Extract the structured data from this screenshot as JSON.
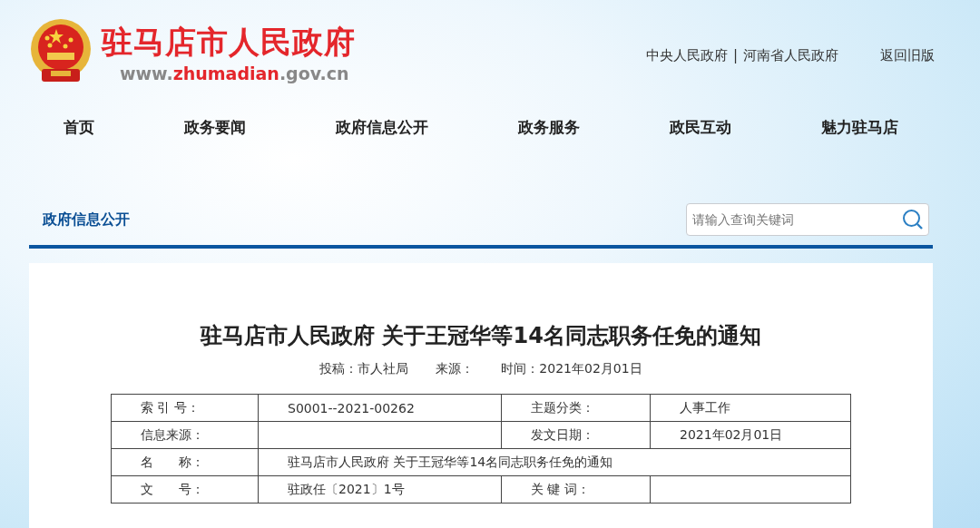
{
  "site": {
    "name": "驻马店市人民政府",
    "url": {
      "prefix": "www.",
      "name": "zhumadian",
      "suffix": ".gov.cn"
    }
  },
  "top_links": [
    "中央人民政府",
    "河南省人民政府"
  ],
  "top_links_separator": "|",
  "old_version_link": "返回旧版",
  "nav": [
    "首页",
    "政务要闻",
    "政府信息公开",
    "政务服务",
    "政民互动",
    "魅力驻马店"
  ],
  "section": {
    "title": "政府信息公开"
  },
  "search": {
    "placeholder": "请输入查询关键词"
  },
  "article": {
    "title": "驻马店市人民政府 关于王冠华等14名同志职务任免的通知",
    "meta": [
      {
        "label": "投稿：",
        "value": "市人社局"
      },
      {
        "label": "来源："
      },
      {
        "label": "时间：",
        "value": "2021年02月01日"
      }
    ],
    "info_table": [
      {
        "label_1": "索 引 号：",
        "value_1": "S0001--2021-00262",
        "label_2": "主题分类：",
        "value_2": "人事工作"
      },
      {
        "label_1": "信息来源：",
        "label_2": "发文日期：",
        "value_2": "2021年02月01日"
      },
      {
        "label_1": "名　　称：",
        "value_1": "驻马店市人民政府 关于王冠华等14名同志职务任免的通知",
        "kind": "wide"
      },
      {
        "label_1": "文　　号：",
        "value_1": "驻政任〔2021〕1号",
        "label_2": "关 键 词："
      }
    ]
  }
}
